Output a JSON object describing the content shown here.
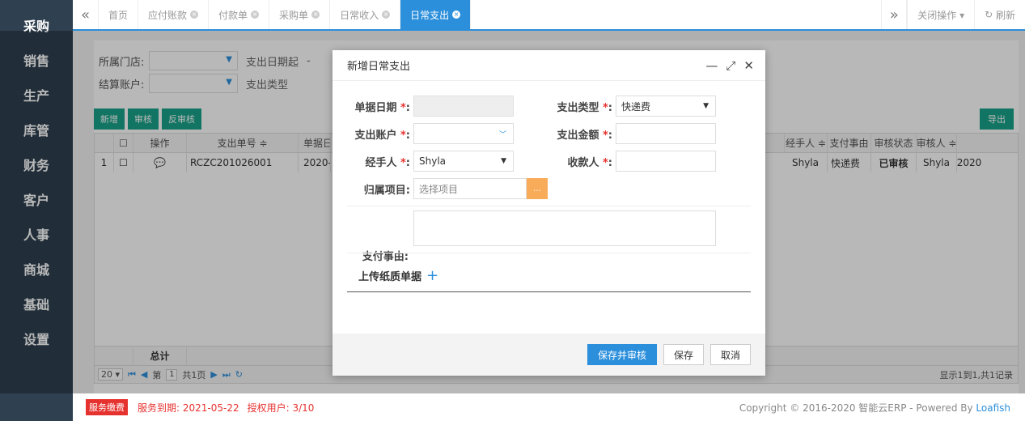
{
  "sidebar": {
    "items": [
      "采购",
      "销售",
      "生产",
      "库管",
      "财务",
      "客户",
      "人事",
      "商城",
      "基础",
      "设置"
    ]
  },
  "tabs": {
    "items": [
      {
        "label": "首页",
        "closable": false
      },
      {
        "label": "应付账款",
        "closable": true
      },
      {
        "label": "付款单",
        "closable": true
      },
      {
        "label": "采购单",
        "closable": true
      },
      {
        "label": "日常收入",
        "closable": true
      },
      {
        "label": "日常支出",
        "closable": true,
        "active": true
      }
    ],
    "close_ops": "关闭操作 ▾",
    "refresh": "刷新"
  },
  "filters": {
    "store_label": "所属门店:",
    "account_label": "结算账户:",
    "date_start": "支出日期起",
    "type_placeholder": "支出类型",
    "dash": "-"
  },
  "toolbar": {
    "add": "新增",
    "audit": "审核",
    "unaudit": "反审核",
    "export": "导出"
  },
  "grid": {
    "headers_left": [
      "操作",
      "支出单号 ≑",
      "单据日"
    ],
    "headers_right": [
      "经手人 ≑",
      "支付事由",
      "审核状态",
      "审核人 ≑"
    ],
    "row": {
      "index": "1",
      "voucher_no": "RCZC201026001",
      "date": "2020-1",
      "handler": "Shyla",
      "reason": "快递费",
      "status": "已审核",
      "auditor": "Shyla",
      "tail": "2020"
    },
    "total_label": "总计"
  },
  "pager": {
    "size": "20 ▾",
    "page_prefix": "第",
    "page": "1",
    "page_total": "共1页",
    "summary": "显示1到1,共1记录"
  },
  "footer": {
    "badge": "服务缴费",
    "expiry": "服务到期: 2021-05-22",
    "users": "授权用户: 3/10",
    "copyright": "Copyright © 2016-2020 智能云ERP - Powered By ",
    "powered": "Loafish"
  },
  "modal": {
    "title": "新增日常支出",
    "date_label": "单据日期",
    "type_label": "支出类型",
    "type_value": "快递费",
    "account_label": "支出账户",
    "amount_label": "支出金额",
    "handler_label": "经手人",
    "handler_value": "Shyla",
    "payee_label": "收款人",
    "project_label": "归属项目:",
    "project_placeholder": "选择项目",
    "reason_label": "支付事由:",
    "upload_label": "上传纸质单据",
    "btn_save_audit": "保存并审核",
    "btn_save": "保存",
    "btn_cancel": "取消"
  },
  "colors": {
    "sidebar_bg": "#2f4050",
    "accent": "#2b8fdc",
    "green": "#1aa389",
    "orange": "#f8ac59",
    "red": "#e6322f"
  }
}
